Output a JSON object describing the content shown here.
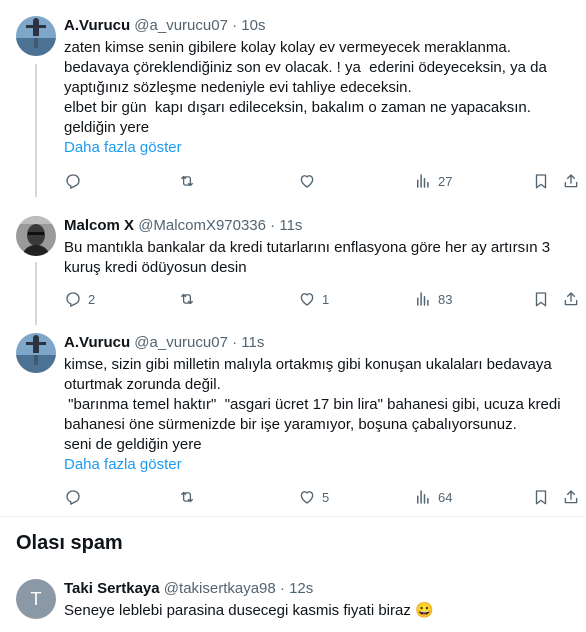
{
  "tweets": [
    {
      "name": "A.Vurucu",
      "handle": "@a_vurucu07",
      "time": "10s",
      "lines": [
        "zaten kimse senin gibilere kolay kolay ev vermeyecek meraklanma.",
        "bedavaya çöreklendiğiniz son ev olacak. ! ya  ederini ödeyeceksin, ya da",
        "yaptığınız sözleşme nedeniyle evi tahliye edeceksin.",
        "elbet bir gün  kapı dışarı edileceksin, bakalım o zaman ne yapacaksın.",
        "geldiğin yere"
      ],
      "show_more": "Daha fazla göster",
      "replies": "",
      "retweets": "",
      "likes": "",
      "views": "27"
    },
    {
      "name": "Malcom X",
      "handle": "@MalcomX970336",
      "time": "11s",
      "lines": [
        "Bu mantıkla bankalar da kredi tutarlarını enflasyona göre her ay artırsın 3",
        "kuruş kredi ödüyosun desin"
      ],
      "show_more": "",
      "replies": "2",
      "retweets": "",
      "likes": "1",
      "views": "83"
    },
    {
      "name": "A.Vurucu",
      "handle": "@a_vurucu07",
      "time": "11s",
      "lines": [
        "kimse, sizin gibi milletin malıyla ortakmış gibi konuşan ukalaları bedavaya",
        "oturtmak zorunda değil.",
        " \"barınma temel haktır\"  \"asgari ücret 17 bin lira\" bahanesi gibi, ucuza kredi",
        "bahanesi öne sürmenizde bir işe yaramıyor, boşuna çabalıyorsunuz.",
        "seni de geldiğin yere"
      ],
      "show_more": "Daha fazla göster",
      "replies": "",
      "retweets": "",
      "likes": "5",
      "views": "64"
    }
  ],
  "spam_section": {
    "title": "Olası spam",
    "tweet": {
      "avatar_letter": "T",
      "name": "Taki Sertkaya",
      "handle": "@takisertkaya98",
      "time": "12s",
      "text": "Seneye leblebi parasina dusecegi kasmis fiyati biraz",
      "emoji": "😀"
    }
  },
  "colors": {
    "text": "#0f1419",
    "secondary": "#536471",
    "link": "#1d9bf0",
    "line": "#cfd9de",
    "divider": "#eff3f4"
  },
  "separator": "·",
  "icons": [
    "reply-icon",
    "retweet-icon",
    "like-icon",
    "views-icon",
    "bookmark-icon",
    "share-icon"
  ]
}
